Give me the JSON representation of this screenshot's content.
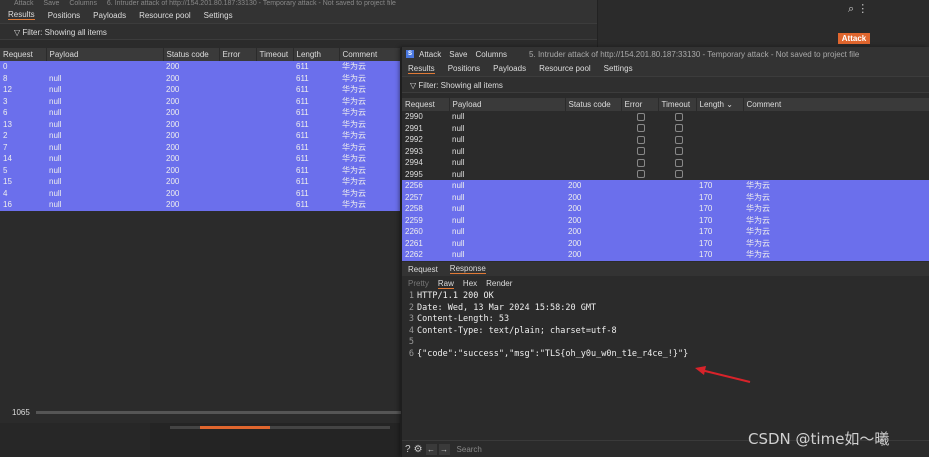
{
  "win1": {
    "menu": [
      "Attack",
      "Save",
      "Columns"
    ],
    "title": "6. Intruder attack of http://154.201.80.187:33130 - Temporary attack - Not saved to project file",
    "tabs": [
      "Results",
      "Positions",
      "Payloads",
      "Resource pool",
      "Settings"
    ],
    "filter": "Filter: Showing all items",
    "columns": [
      "Request",
      "Payload",
      "Status code",
      "Error",
      "Timeout",
      "Length",
      "Comment"
    ],
    "rows": [
      [
        "0",
        "",
        "200",
        "",
        "",
        "611",
        "华为云"
      ],
      [
        "8",
        "null",
        "200",
        "",
        "",
        "611",
        "华为云"
      ],
      [
        "12",
        "null",
        "200",
        "",
        "",
        "611",
        "华为云"
      ],
      [
        "3",
        "null",
        "200",
        "",
        "",
        "611",
        "华为云"
      ],
      [
        "6",
        "null",
        "200",
        "",
        "",
        "611",
        "华为云"
      ],
      [
        "13",
        "null",
        "200",
        "",
        "",
        "611",
        "华为云"
      ],
      [
        "2",
        "null",
        "200",
        "",
        "",
        "611",
        "华为云"
      ],
      [
        "7",
        "null",
        "200",
        "",
        "",
        "611",
        "华为云"
      ],
      [
        "14",
        "null",
        "200",
        "",
        "",
        "611",
        "华为云"
      ],
      [
        "5",
        "null",
        "200",
        "",
        "",
        "611",
        "华为云"
      ],
      [
        "15",
        "null",
        "200",
        "",
        "",
        "611",
        "华为云"
      ],
      [
        "4",
        "null",
        "200",
        "",
        "",
        "611",
        "华为云"
      ],
      [
        "16",
        "null",
        "200",
        "",
        "",
        "611",
        "华为云"
      ]
    ],
    "count": "1065",
    "attack_button": "Attack"
  },
  "win2": {
    "logo": "S",
    "menu": [
      "Attack",
      "Save",
      "Columns"
    ],
    "title": "5. Intruder attack of http://154.201.80.187:33130 - Temporary attack - Not saved to project file",
    "tabs": [
      "Results",
      "Positions",
      "Payloads",
      "Resource pool",
      "Settings"
    ],
    "filter": "Filter: Showing all items",
    "columns": [
      "Request",
      "Payload",
      "Status code",
      "Error",
      "Timeout",
      "Length",
      "Comment"
    ],
    "plain_rows": [
      [
        "2990",
        "null"
      ],
      [
        "2991",
        "null"
      ],
      [
        "2992",
        "null"
      ],
      [
        "2993",
        "null"
      ],
      [
        "2994",
        "null"
      ],
      [
        "2995",
        "null"
      ]
    ],
    "sel_rows": [
      [
        "2256",
        "null",
        "200",
        "170",
        "华为云"
      ],
      [
        "2257",
        "null",
        "200",
        "170",
        "华为云"
      ],
      [
        "2258",
        "null",
        "200",
        "170",
        "华为云"
      ],
      [
        "2259",
        "null",
        "200",
        "170",
        "华为云"
      ],
      [
        "2260",
        "null",
        "200",
        "170",
        "华为云"
      ],
      [
        "2261",
        "null",
        "200",
        "170",
        "华为云"
      ],
      [
        "2262",
        "null",
        "200",
        "170",
        "华为云"
      ]
    ],
    "rr_tabs": [
      "Request",
      "Response"
    ],
    "view_tabs": [
      "Pretty",
      "Raw",
      "Hex",
      "Render"
    ],
    "response_lines": [
      "HTTP/1.1 200 OK",
      "Date: Wed, 13 Mar 2024 15:58:20 GMT",
      "Content-Length: 53",
      "Content-Type: text/plain; charset=utf-8",
      "",
      "{\"code\":\"success\",\"msg\":\"TLS{oh_y0u_w0n_t1e_r4ce_!}\"}"
    ],
    "search_placeholder": "Search"
  },
  "watermark": "CSDN @time如～曦"
}
